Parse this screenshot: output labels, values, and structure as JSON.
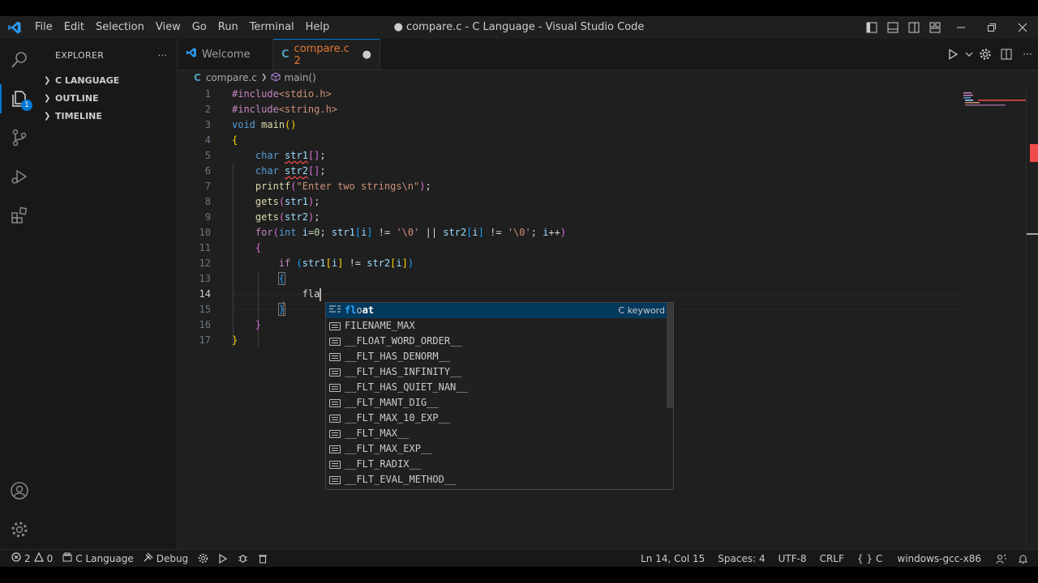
{
  "titlebar": {
    "menu": [
      "File",
      "Edit",
      "Selection",
      "View",
      "Go",
      "Run",
      "Terminal",
      "Help"
    ],
    "title": "● compare.c - C Language - Visual Studio Code"
  },
  "activity": {
    "explorer_badge": "1"
  },
  "sidebar": {
    "title": "EXPLORER",
    "more": "···",
    "sections": [
      "C LANGUAGE",
      "OUTLINE",
      "TIMELINE"
    ]
  },
  "tabs": [
    {
      "label": "Welcome",
      "active": false
    },
    {
      "label": "compare.c 2",
      "active": true,
      "dirty": "●"
    }
  ],
  "breadcrumb": {
    "file": "compare.c",
    "symbol": "main()"
  },
  "editor": {
    "current_line": 14,
    "line_numbers": [
      "1",
      "2",
      "3",
      "4",
      "5",
      "6",
      "7",
      "8",
      "9",
      "10",
      "11",
      "12",
      "13",
      "14",
      "15",
      "16",
      "17"
    ],
    "typed": "fla"
  },
  "suggest": {
    "items": [
      {
        "label": "float",
        "match": "fl",
        "rest": "o",
        "tail": "at",
        "detail": "C keyword",
        "kind": "keyword-icon"
      },
      {
        "label": "FILENAME_MAX",
        "kind": "text-icon"
      },
      {
        "label": "__FLOAT_WORD_ORDER__",
        "kind": "text-icon"
      },
      {
        "label": "__FLT_HAS_DENORM__",
        "kind": "text-icon"
      },
      {
        "label": "__FLT_HAS_INFINITY__",
        "kind": "text-icon"
      },
      {
        "label": "__FLT_HAS_QUIET_NAN__",
        "kind": "text-icon"
      },
      {
        "label": "__FLT_MANT_DIG__",
        "kind": "text-icon"
      },
      {
        "label": "__FLT_MAX_10_EXP__",
        "kind": "text-icon"
      },
      {
        "label": "__FLT_MAX__",
        "kind": "text-icon"
      },
      {
        "label": "__FLT_MAX_EXP__",
        "kind": "text-icon"
      },
      {
        "label": "__FLT_RADIX__",
        "kind": "text-icon"
      },
      {
        "label": "__FLT_EVAL_METHOD__",
        "kind": "text-icon"
      }
    ]
  },
  "status": {
    "errors": "2",
    "warnings": "0",
    "config": "C Language",
    "debug": "Debug",
    "position": "Ln 14, Col 15",
    "spaces": "Spaces: 4",
    "encoding": "UTF-8",
    "eol": "CRLF",
    "language": "C",
    "compiler": "windows-gcc-x86"
  },
  "colors": {
    "accent": "#0078d4",
    "tab_active_text": "#e37933",
    "error": "#f14c4c"
  }
}
